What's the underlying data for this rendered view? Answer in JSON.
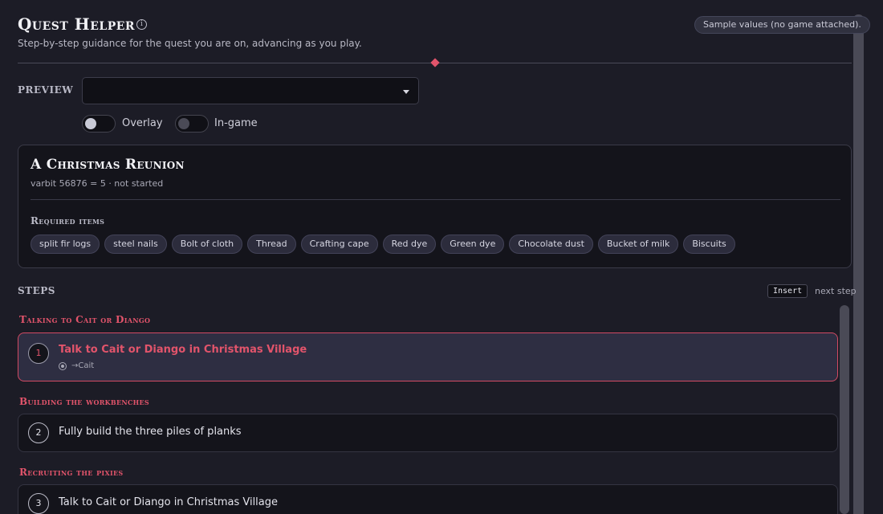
{
  "header": {
    "title": "Quest Helper",
    "subtitle": "Step-by-step guidance for the quest you are on, advancing as you play.",
    "info_icon": "info-icon",
    "sample_badge": "Sample values (no game attached)."
  },
  "preview": {
    "label": "PREVIEW",
    "select_value": "",
    "toggles": [
      {
        "label": "Overlay",
        "on": false
      },
      {
        "label": "In-game",
        "on": false
      }
    ]
  },
  "quest": {
    "name": "A Christmas Reunion",
    "meta": "varbit 56876 = 5  ·  not started",
    "required_label": "Required items",
    "items": [
      "split fir logs",
      "steel nails",
      "Bolt of cloth",
      "Thread",
      "Crafting cape",
      "Red dye",
      "Green dye",
      "Chocolate dust",
      "Bucket of milk",
      "Biscuits"
    ]
  },
  "steps": {
    "label": "STEPS",
    "key": "Insert",
    "key_hint": "next step",
    "sections": [
      {
        "title": "Talking to Cait or Diango",
        "steps": [
          {
            "num": "1",
            "text": "Talk to Cait or Diango in Christmas Village",
            "sub": "→Cait",
            "active": true
          }
        ]
      },
      {
        "title": "Building the workbenches",
        "steps": [
          {
            "num": "2",
            "text": "Fully build the three piles of planks",
            "active": false
          }
        ]
      },
      {
        "title": "Recruiting the pixies",
        "steps": [
          {
            "num": "3",
            "text": "Talk to Cait or Diango in Christmas Village",
            "active": false
          }
        ]
      }
    ]
  },
  "colors": {
    "accent": "#e2546b",
    "background": "#1c1c26",
    "card": "#14141b",
    "active_step": "#2e2e42"
  }
}
